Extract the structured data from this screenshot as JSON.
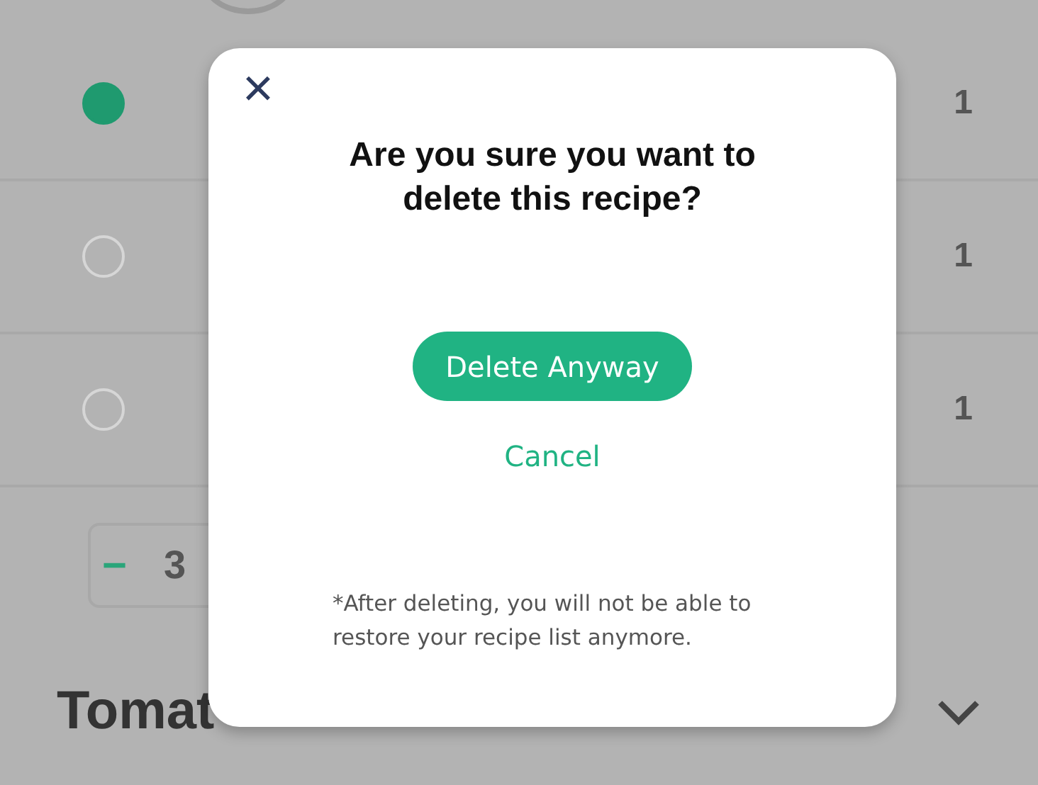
{
  "background": {
    "ingredients": [
      {
        "checked": true,
        "quantity": "1"
      },
      {
        "checked": false,
        "quantity": "1"
      },
      {
        "checked": false,
        "quantity": "1"
      }
    ],
    "stepper": {
      "minus": "−",
      "value": "3"
    },
    "section_title": "Tomat"
  },
  "dialog": {
    "close": "×",
    "title": "Are you sure you want to delete this recipe?",
    "confirm_button": "Delete Anyway",
    "cancel_button": "Cancel",
    "note": "*After deleting, you will not be able to restore your recipe list anymore."
  }
}
